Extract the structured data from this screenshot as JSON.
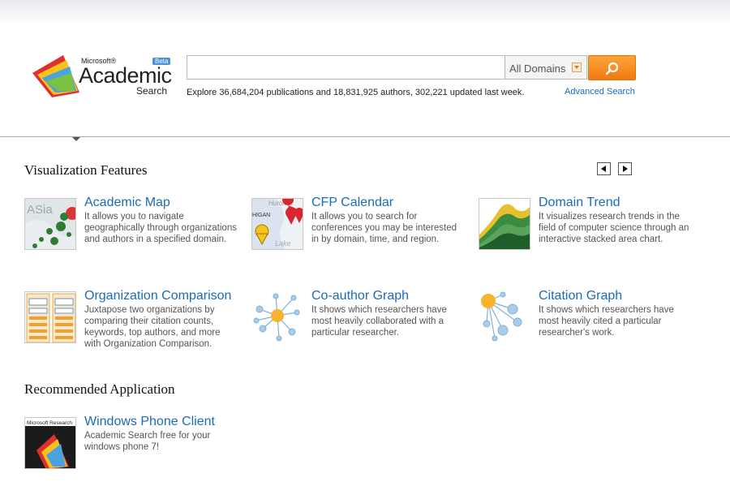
{
  "logo": {
    "microsoft": "Microsoft®",
    "beta": "Beta",
    "main": "Academic",
    "sub": "Search"
  },
  "search": {
    "value": "",
    "domain": "All Domains",
    "explore": "Explore 36,684,204 publications and 18,831,925 authors, 302,221 updated last week.",
    "advanced": "Advanced Search"
  },
  "visualization": {
    "title": "Visualization Features",
    "features": [
      {
        "title": "Academic Map",
        "desc": "It allows you to navigate geographically through organizations and authors in a specified domain."
      },
      {
        "title": "CFP Calendar",
        "desc": "It allows you to search for conferences you may be interested in by domain, time, and region."
      },
      {
        "title": "Domain Trend",
        "desc": "It visualizes research trends in the field of computer science through an interactive stacked area chart."
      },
      {
        "title": "Organization Comparison",
        "desc": "Juxtapose two organizations by comparing their citation counts, keywords, top authors, and more with Organization Comparison."
      },
      {
        "title": "Co-author Graph",
        "desc": "It shows which researchers have most heavily collaborated with a particular researcher."
      },
      {
        "title": "Citation Graph",
        "desc": "It shows which researchers have most heavily cited a particular researcher's work."
      }
    ]
  },
  "recommended": {
    "title": "Recommended Application",
    "app": {
      "title": "Windows Phone Client",
      "desc": "Academic Search free for your windows phone 7!",
      "thumb_label": "Microsoft Research"
    }
  },
  "map_labels": {
    "asia": "ASia",
    "huron": "Huron",
    "michigan": "HIGAN",
    "lake": "Lake"
  },
  "colors": {
    "link": "#1a6bb8",
    "search_button": "#f58a1f",
    "map_marker": "#2e7d32"
  }
}
